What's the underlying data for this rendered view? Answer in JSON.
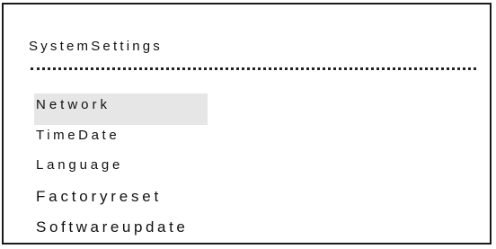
{
  "panel": {
    "title": "SystemSettings"
  },
  "menu": {
    "items": [
      {
        "label": "Network",
        "selected": true
      },
      {
        "label": "TimeDate"
      },
      {
        "label": "Language"
      },
      {
        "label": "Factoryreset"
      },
      {
        "label": "Softwareupdate"
      }
    ]
  },
  "colors": {
    "border": "#1a1a1a",
    "selection_highlight": "#e6e6e6",
    "text": "#111111"
  }
}
